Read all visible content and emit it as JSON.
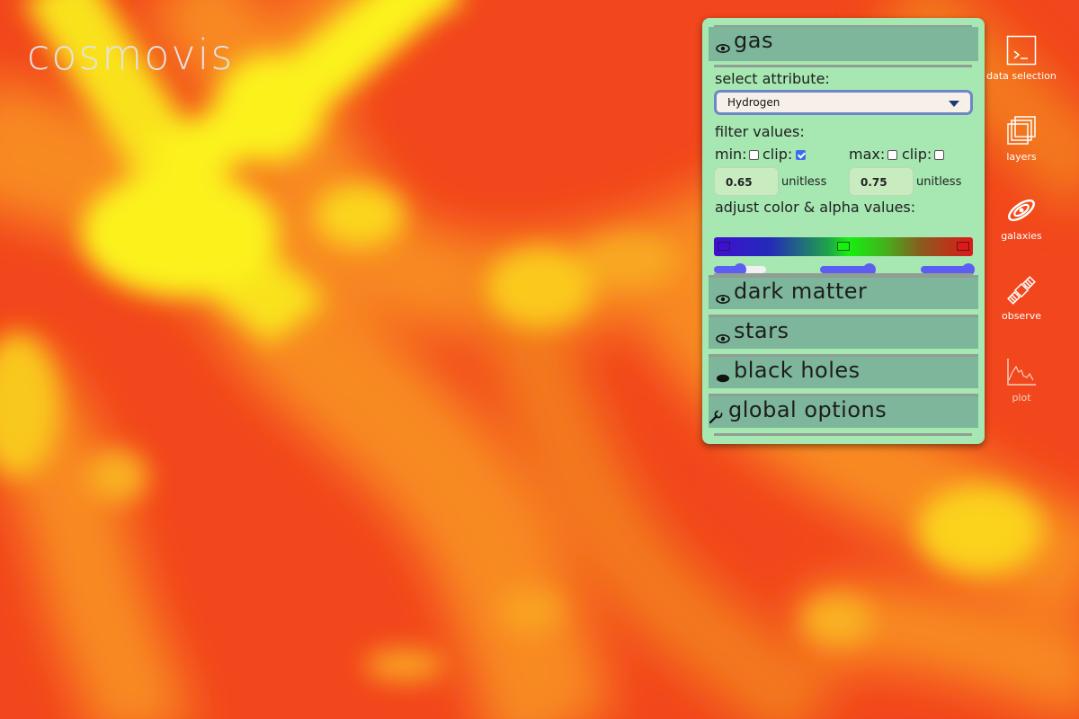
{
  "app": {
    "title": "cosmovis"
  },
  "panel": {
    "sections": [
      {
        "id": "gas",
        "label": "gas",
        "icon": "eye-icon",
        "expanded": true
      },
      {
        "id": "dark-matter",
        "label": "dark matter",
        "icon": "eye-icon"
      },
      {
        "id": "stars",
        "label": "stars",
        "icon": "eye-icon"
      },
      {
        "id": "black-holes",
        "label": "black holes",
        "icon": "eye-closed-icon"
      },
      {
        "id": "global-options",
        "label": "global options",
        "icon": "wrench-icon"
      }
    ],
    "gas": {
      "select_label": "select attribute:",
      "attribute": "Hydrogen",
      "filter_label": "filter values:",
      "min_label": "min:",
      "max_label": "max:",
      "clip_label": "clip:",
      "min_checked": false,
      "min_clip_checked": true,
      "max_checked": false,
      "max_clip_checked": false,
      "min_value": "0.65",
      "max_value": "0.75",
      "unit": "unitless",
      "color_label": "adjust color & alpha values:",
      "color_stops": [
        {
          "color": "#3f0fd4",
          "position": 0.0
        },
        {
          "color": "#16f00f",
          "position": 0.5
        },
        {
          "color": "#e11818",
          "position": 1.0
        }
      ],
      "alpha_levels": [
        0.5,
        0.95,
        0.92
      ]
    }
  },
  "sidebar": {
    "items": [
      {
        "label": "data selection",
        "icon": "terminal-icon"
      },
      {
        "label": "layers",
        "icon": "layers-icon"
      },
      {
        "label": "galaxies",
        "icon": "galaxy-icon"
      },
      {
        "label": "observe",
        "icon": "satellite-icon"
      },
      {
        "label": "plot",
        "icon": "plot-icon"
      }
    ]
  },
  "colors": {
    "accent": "#5b5ef0",
    "panel_bg": "#a6e7b2",
    "section_header": "#7db69a",
    "viz_base": "#f2461c",
    "viz_highlight": "#fbf21c"
  }
}
